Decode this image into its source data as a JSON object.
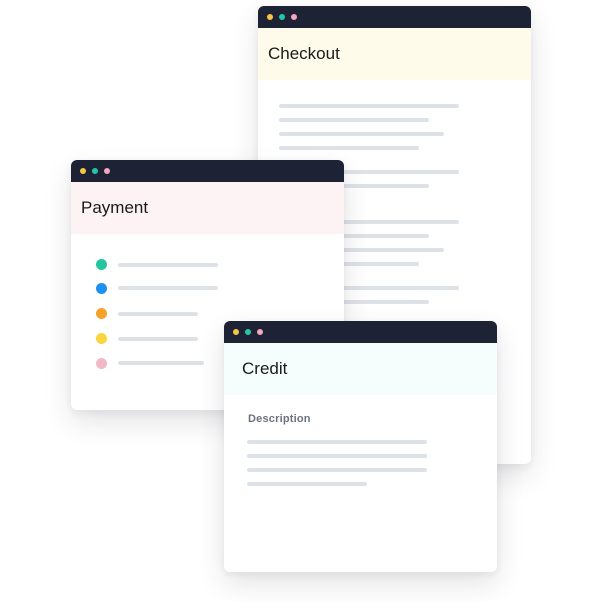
{
  "colors": {
    "titlebar": "#1e2235",
    "dot_yellow": "#f6c744",
    "dot_teal": "#22c7a9",
    "dot_pink": "#f4a6c0",
    "skeleton_line": "#dde2e8"
  },
  "windows": {
    "checkout": {
      "title": "Checkout",
      "header_bg": "#fffbeb"
    },
    "payment": {
      "title": "Payment",
      "header_bg": "#fdf3f5",
      "bullets": [
        {
          "color": "#23c49e",
          "icon": "green-dot-icon"
        },
        {
          "color": "#1e90f0",
          "icon": "blue-dot-icon"
        },
        {
          "color": "#f7a12a",
          "icon": "orange-dot-icon"
        },
        {
          "color": "#fbd53e",
          "icon": "yellow-dot-icon"
        },
        {
          "color": "#f2b8c6",
          "icon": "pink-dot-icon"
        }
      ]
    },
    "credit": {
      "title": "Credit",
      "header_bg": "#f5fdfd",
      "description_label": "Description"
    }
  }
}
